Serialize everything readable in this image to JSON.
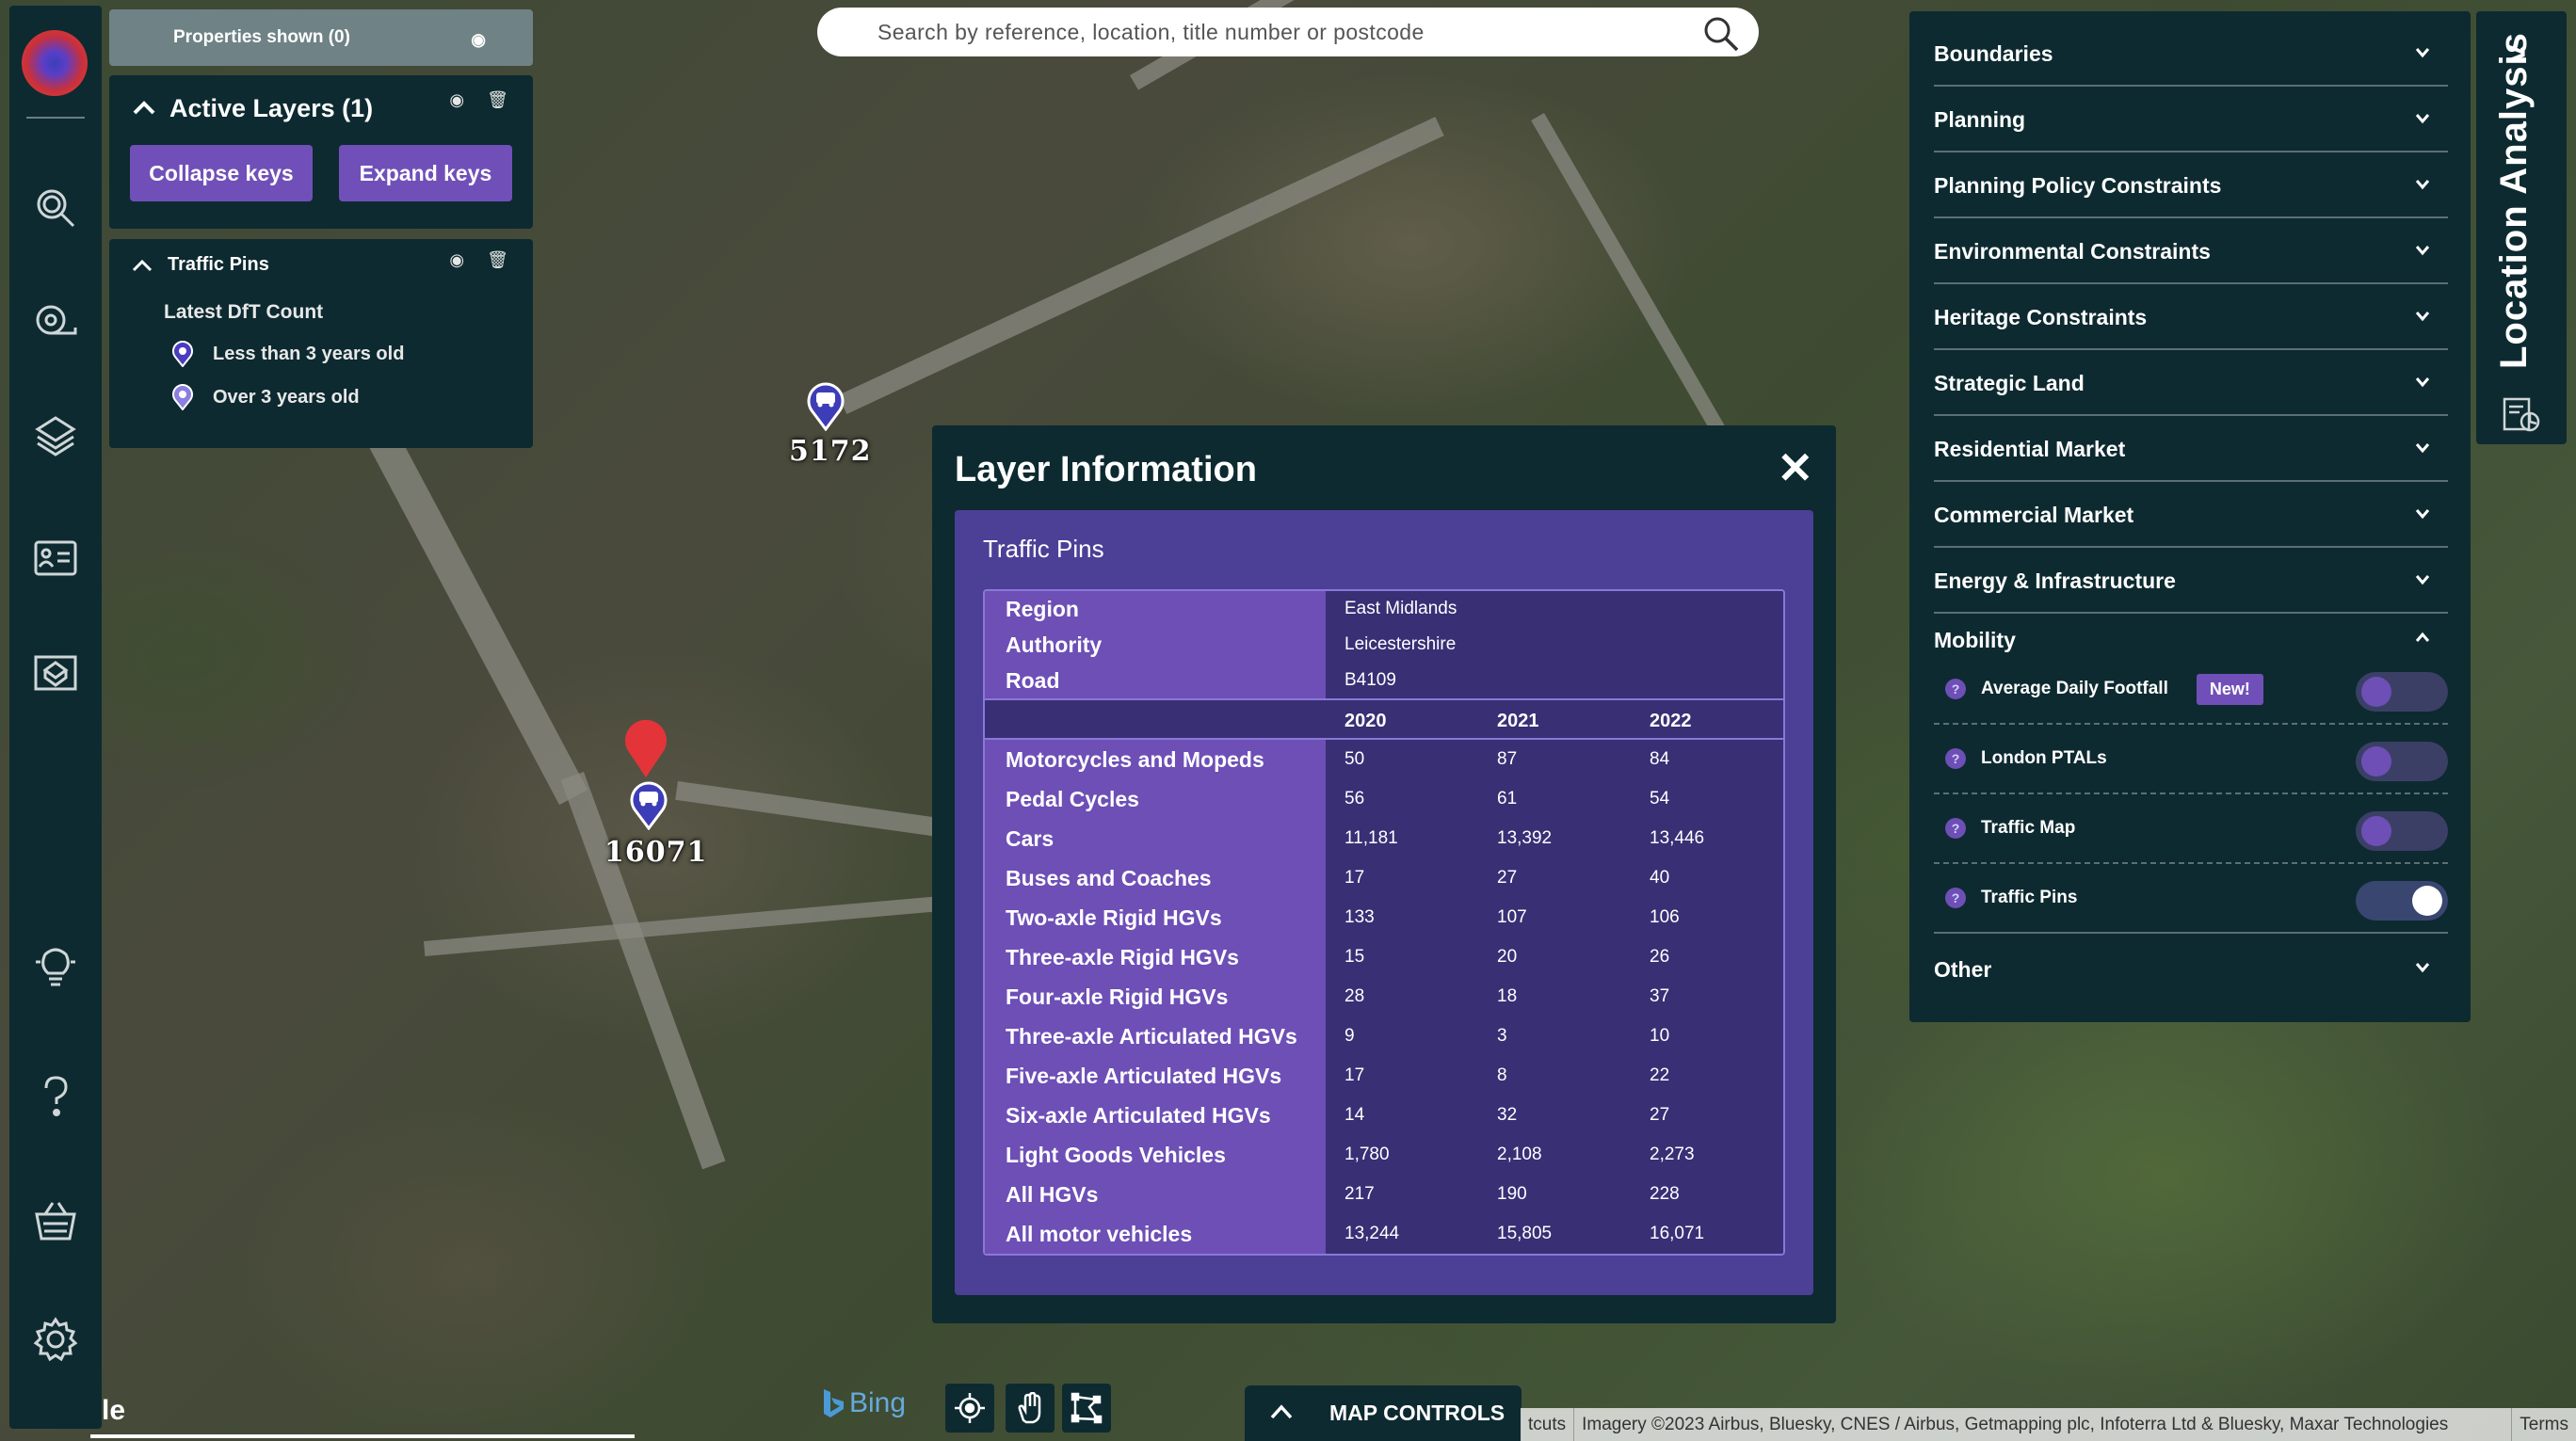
{
  "properties_bar": {
    "label": "Properties shown (0)"
  },
  "active_layers": {
    "title": "Active Layers (1)",
    "collapse_label": "Collapse keys",
    "expand_label": "Expand keys"
  },
  "key_panel": {
    "title": "Traffic Pins",
    "subtitle": "Latest DfT Count",
    "items": [
      {
        "label": "Less than 3 years old",
        "icon": "pin-dark-icon"
      },
      {
        "label": "Over 3 years old",
        "icon": "pin-light-icon"
      }
    ]
  },
  "search": {
    "placeholder": "Search by reference, location, title number or postcode"
  },
  "markers": [
    {
      "label": "5172"
    },
    {
      "label": "16071"
    }
  ],
  "modal": {
    "title": "Layer Information",
    "close": "✕",
    "subtitle": "Traffic Pins",
    "meta": [
      {
        "label": "Region",
        "value": "East Midlands"
      },
      {
        "label": "Authority",
        "value": "Leicestershire"
      },
      {
        "label": "Road",
        "value": "B4109"
      }
    ],
    "years": [
      "2020",
      "2021",
      "2022"
    ],
    "rows": [
      {
        "label": "Motorcycles and Mopeds",
        "values": [
          "50",
          "87",
          "84"
        ]
      },
      {
        "label": "Pedal Cycles",
        "values": [
          "56",
          "61",
          "54"
        ]
      },
      {
        "label": "Cars",
        "values": [
          "11,181",
          "13,392",
          "13,446"
        ]
      },
      {
        "label": "Buses and Coaches",
        "values": [
          "17",
          "27",
          "40"
        ]
      },
      {
        "label": "Two-axle Rigid HGVs",
        "values": [
          "133",
          "107",
          "106"
        ]
      },
      {
        "label": "Three-axle Rigid HGVs",
        "values": [
          "15",
          "20",
          "26"
        ]
      },
      {
        "label": "Four-axle Rigid HGVs",
        "values": [
          "28",
          "18",
          "37"
        ]
      },
      {
        "label": "Three-axle Articulated HGVs",
        "values": [
          "9",
          "3",
          "10"
        ]
      },
      {
        "label": "Five-axle Articulated HGVs",
        "values": [
          "17",
          "8",
          "22"
        ]
      },
      {
        "label": "Six-axle Articulated HGVs",
        "values": [
          "14",
          "32",
          "27"
        ]
      },
      {
        "label": "Light Goods Vehicles",
        "values": [
          "1,780",
          "2,108",
          "2,273"
        ]
      },
      {
        "label": "All HGVs",
        "values": [
          "217",
          "190",
          "228"
        ]
      },
      {
        "label": "All motor vehicles",
        "values": [
          "13,244",
          "15,805",
          "16,071"
        ]
      }
    ]
  },
  "categories": [
    "Boundaries",
    "Planning",
    "Planning Policy Constraints",
    "Environmental Constraints",
    "Heritage Constraints",
    "Strategic Land",
    "Residential Market",
    "Commercial Market",
    "Energy & Infrastructure"
  ],
  "mobility": {
    "title": "Mobility",
    "items": [
      {
        "label": "Average Daily Footfall",
        "badge": "New!",
        "enabled": false
      },
      {
        "label": "London PTALs",
        "enabled": false
      },
      {
        "label": "Traffic Map",
        "enabled": false
      },
      {
        "label": "Traffic Pins",
        "enabled": true
      }
    ]
  },
  "other": {
    "label": "Other"
  },
  "location_tab": {
    "label": "Location Analysis"
  },
  "bottom": {
    "map_controls": "MAP CONTROLS",
    "bing": "Bing",
    "le_text": "le",
    "attribution": [
      "tcuts",
      "Imagery ©2023 Airbus, Bluesky, CNES / Airbus, Getmapping plc, Infoterra Ltd & Bluesky, Maxar Technologies",
      "Terms"
    ]
  },
  "colors": {
    "panel": "#0d2a30",
    "accent_purple": "#7050b8",
    "table_label": "#6d4fb6",
    "table_value": "#382f75",
    "marker_red": "#e3343a",
    "marker_blue": "#3b3fb8"
  }
}
